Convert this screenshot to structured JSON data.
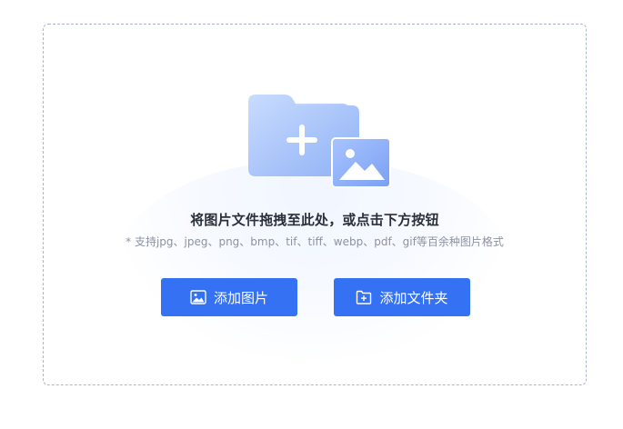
{
  "upload": {
    "main_text": "将图片文件拖拽至此处，或点击下方按钮",
    "sub_text": "* 支持jpg、jpeg、png、bmp、tif、tiff、webp、pdf、gif等百余种图片格式",
    "buttons": {
      "add_images": "添加图片",
      "add_folder": "添加文件夹"
    }
  },
  "icons": {
    "illustration": "folder-plus-image-illustration",
    "add_images": "image-icon",
    "add_folder": "folder-plus-icon"
  },
  "colors": {
    "primary_button": "#3571f3",
    "main_text": "#2b2f38",
    "sub_text": "#8c93a1",
    "dashed_border": "#a9b6cf"
  }
}
